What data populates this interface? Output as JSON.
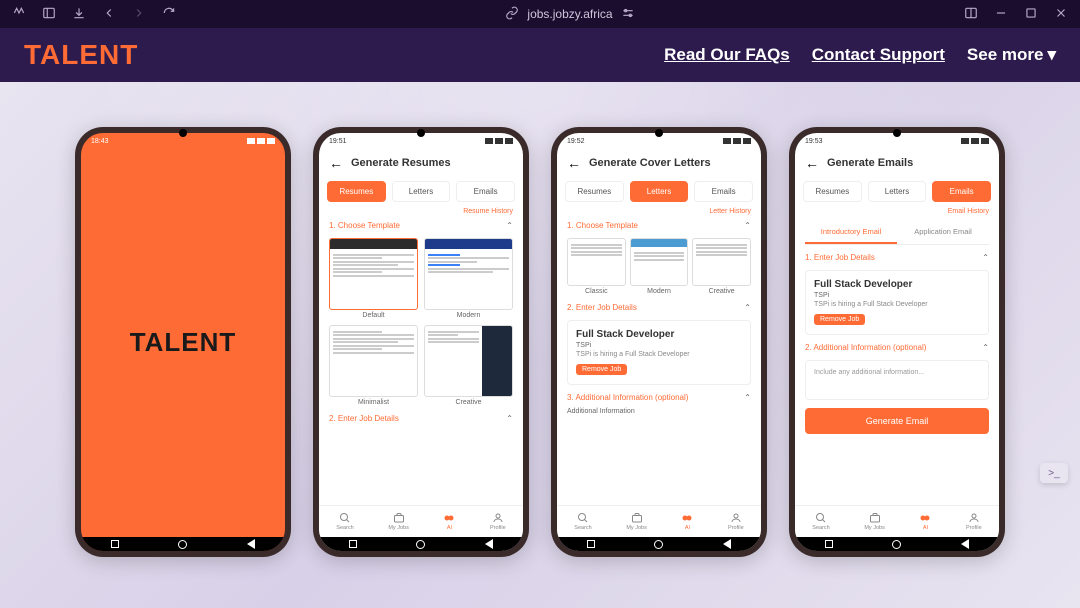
{
  "chrome": {
    "url": "jobs.jobzy.africa"
  },
  "nav": {
    "logo": "TALENT",
    "faqs": "Read Our FAQs",
    "contact": "Contact Support",
    "see_more": "See more"
  },
  "phone1": {
    "time": "18:43",
    "logo": "TALENT"
  },
  "phone2": {
    "time": "19:51",
    "title": "Generate Resumes",
    "tabs": {
      "resumes": "Resumes",
      "letters": "Letters",
      "emails": "Emails"
    },
    "history": "Resume History",
    "section1": "1. Choose Template",
    "templates": {
      "default": "Default",
      "modern": "Modern",
      "minimalist": "Minimalist",
      "creative": "Creative"
    },
    "section2": "2. Enter Job Details",
    "bottomnav": {
      "search": "Search",
      "myjobs": "My Jobs",
      "ai": "AI",
      "profile": "Profile"
    }
  },
  "phone3": {
    "time": "19:52",
    "title": "Generate Cover Letters",
    "tabs": {
      "resumes": "Resumes",
      "letters": "Letters",
      "emails": "Emails"
    },
    "history": "Letter History",
    "section1": "1. Choose Template",
    "templates": {
      "classic": "Classic",
      "modern": "Modern",
      "creative": "Creative"
    },
    "section2": "2. Enter Job Details",
    "job": {
      "title": "Full Stack Developer",
      "company": "TSPi",
      "desc": "TSPi is hiring a Full Stack Developer",
      "remove": "Remove Job"
    },
    "section3": "3. Additional Information (optional)",
    "addl_label": "Additional Information"
  },
  "phone4": {
    "time": "19:53",
    "title": "Generate Emails",
    "tabs": {
      "resumes": "Resumes",
      "letters": "Letters",
      "emails": "Emails"
    },
    "history": "Email History",
    "subtabs": {
      "intro": "Introductory Email",
      "app": "Application Email"
    },
    "section1": "1. Enter Job Details",
    "job": {
      "title": "Full Stack Developer",
      "company": "TSPi",
      "desc": "TSPi is hiring a Full Stack Developer",
      "remove": "Remove Job"
    },
    "section2": "2. Additional Information (optional)",
    "addl_placeholder": "Include any additional information...",
    "generate": "Generate Email"
  },
  "fab": ">_"
}
